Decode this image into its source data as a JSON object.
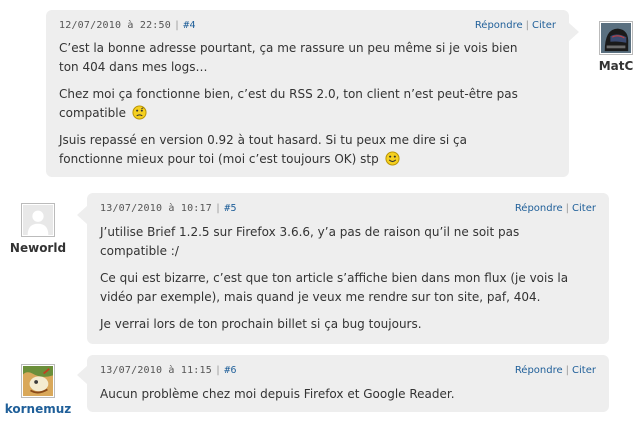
{
  "comments": [
    {
      "date": "12/07/2010 à 22:50",
      "number": "#4",
      "reply": "Répondre",
      "cite": "Citer",
      "author": "MatC",
      "paragraphs": [
        [
          "C’est la bonne adresse pourtant, ça me rassure un peu même si je vois bien",
          "ton 404 dans mes logs…"
        ],
        [
          "Chez moi ça fonctionne bien, c’est du RSS 2.0, ton client n’est peut-être pas",
          "compatible"
        ],
        [
          "Jsuis repassé en version 0.92 à tout hasard. Si tu peux me dire si ça",
          "fonctionne mieux pour toi (moi c’est toujours OK) stp"
        ]
      ]
    },
    {
      "date": "13/07/2010 à 10:17",
      "number": "#5",
      "reply": "Répondre",
      "cite": "Citer",
      "author": "Neworld",
      "paragraphs": [
        [
          "J’utilise Brief 1.2.5 sur Firefox 3.6.6, y’a pas de raison qu’il ne soit pas",
          "compatible :/"
        ],
        [
          "Ce qui est bizarre, c’est que ton article s’affiche bien dans mon flux (je vois la",
          "vidéo par exemple), mais quand je veux me rendre sur ton site, paf, 404."
        ],
        [
          "Je verrai lors de ton prochain billet si ça bug toujours."
        ]
      ]
    },
    {
      "date": "13/07/2010 à 11:15",
      "number": "#6",
      "reply": "Répondre",
      "cite": "Citer",
      "author": "kornemuz",
      "paragraphs": [
        [
          "Aucun problème chez moi depuis Firefox et Google Reader."
        ]
      ]
    }
  ],
  "icons": {
    "worried_smiley": "worried-smiley-icon",
    "happy_smiley": "happy-smiley-icon"
  },
  "colors": {
    "bubble": "#eeeeee",
    "link": "#1f5f99",
    "text": "#333333"
  }
}
